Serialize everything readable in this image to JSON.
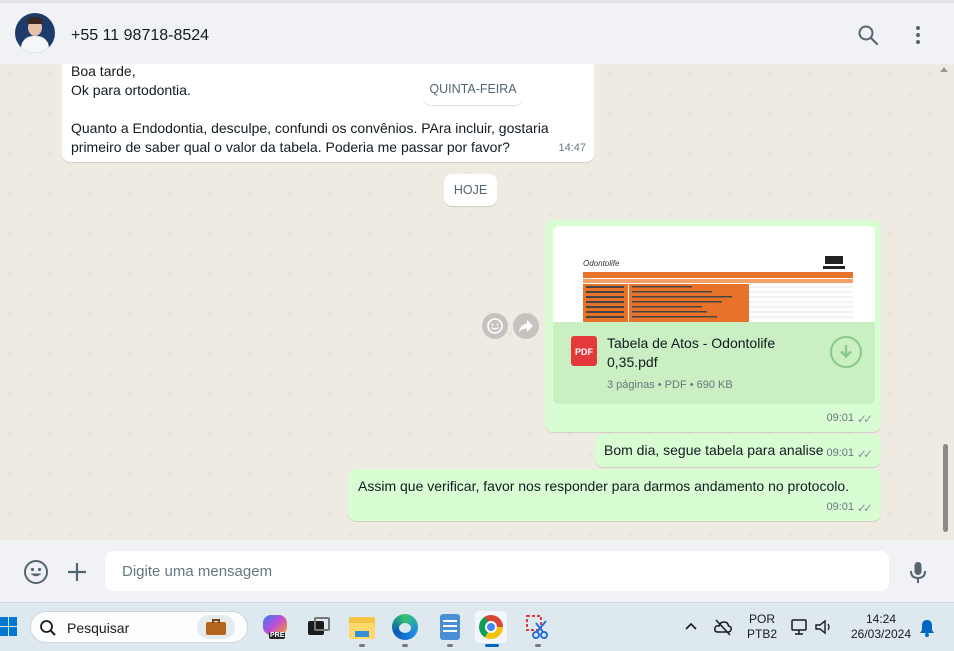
{
  "header": {
    "contact_name": "+55 11 98718-8524",
    "search_icon": "search-icon",
    "menu_icon": "kebab-menu-icon"
  },
  "chat": {
    "messages": [
      {
        "direction": "in",
        "lines": [
          "Boa tarde,",
          "Ok para ortodontia.",
          "",
          "Quanto a Endodontia, desculpe, confundi os convênios. PAra incluir, gostaria",
          "primeiro de saber qual o valor da tabela. Poderia me passar por favor?"
        ],
        "time": "14:47"
      },
      {
        "direction": "out",
        "type": "document",
        "file_name": "Tabela de Atos - Odontolife 0,35.pdf",
        "file_meta": "3 páginas • PDF • 690 KB",
        "file_badge": "PDF",
        "thumb_logo": "Odontolife",
        "time": "09:01"
      },
      {
        "direction": "out",
        "text": "Bom dia, segue tabela para analise",
        "time": "09:01"
      },
      {
        "direction": "out",
        "text": "Assim que verificar, favor nos responder para darmos andamento no protocolo.",
        "time": "09:01"
      }
    ],
    "date_labels": {
      "thursday": "QUINTA-FEIRA",
      "today": "HOJE"
    }
  },
  "composer": {
    "placeholder": "Digite uma mensagem"
  },
  "taskbar": {
    "search_label": "Pesquisar",
    "lang_line1": "POR",
    "lang_line2": "PTB2",
    "clock_time": "14:24",
    "clock_date": "26/03/2024",
    "copilot_badge": "PRE"
  },
  "colors": {
    "outgoing_bubble": "#d9fdd3",
    "incoming_bubble": "#ffffff",
    "chat_bg": "#efeae2",
    "accent_tick": "#8696a0"
  }
}
